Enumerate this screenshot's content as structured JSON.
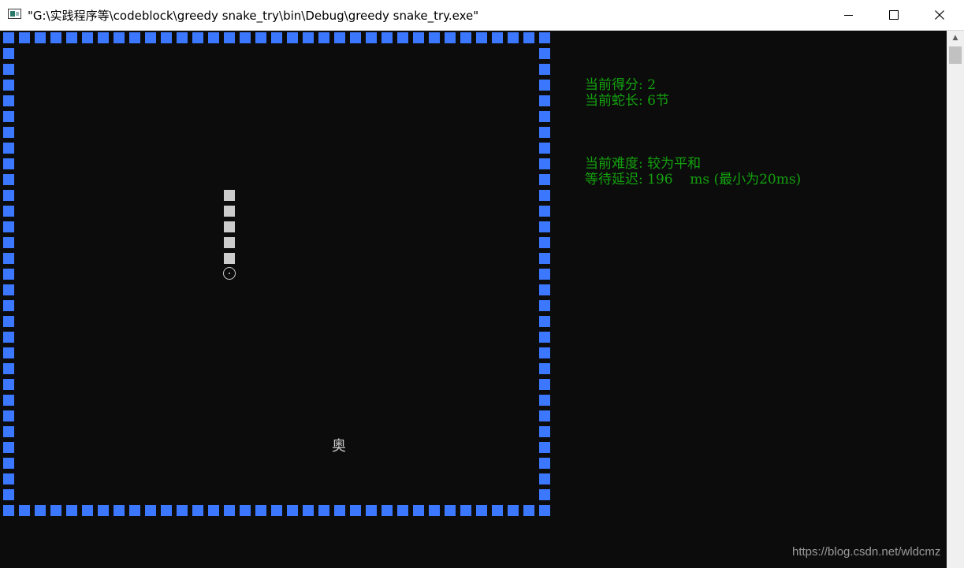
{
  "window": {
    "title": "\"G:\\实践程序等\\codeblock\\greedy snake_try\\bin\\Debug\\greedy snake_try.exe\"",
    "icon": "console-app-icon",
    "minimize_icon": "minimize-icon",
    "maximize_icon": "maximize-icon",
    "close_icon": "close-icon"
  },
  "game": {
    "wall_color": "#3b78ff",
    "snake_color": "#cccccc",
    "snake_head_symbol": "⊙",
    "food_char": "奥"
  },
  "info": {
    "color": "#13a10e",
    "score_line": "当前得分: 2",
    "length_line": "当前蛇长: 6节",
    "difficulty_line": "当前难度: 较为平和",
    "delay_line": "等待延迟: 196    ms (最小为20ms)"
  },
  "watermark": "https://blog.csdn.net/wldcmz"
}
